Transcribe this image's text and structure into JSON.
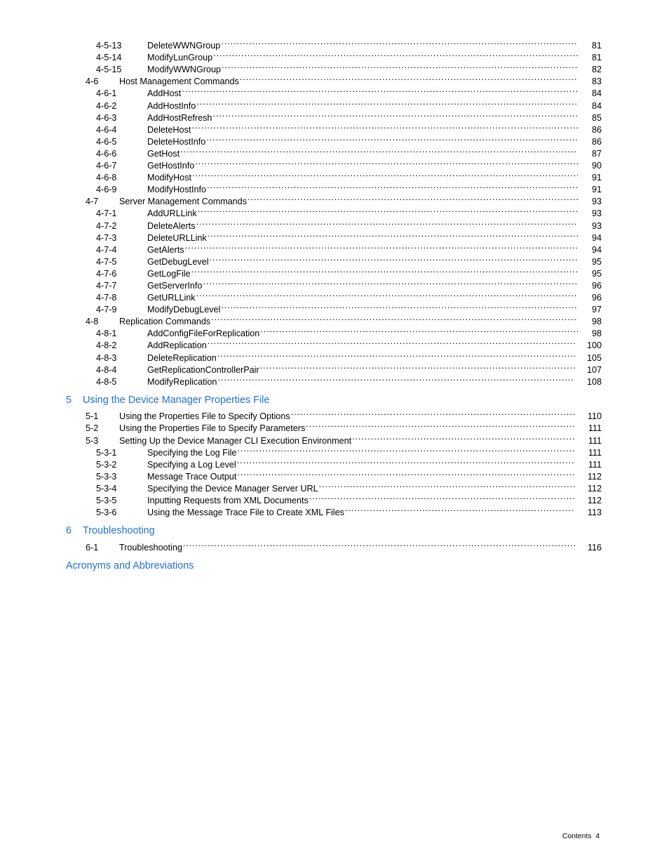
{
  "document": {
    "type": "table-of-contents",
    "footer_text": "Contents  4",
    "accent_color": "#2272D6",
    "text_color": "#000000",
    "background_color": "#FFFFFF"
  },
  "toc": {
    "entries": [
      {
        "kind": "item",
        "level": 3,
        "number": "4-5-13",
        "title": "DeleteWWNGroup",
        "page": "81"
      },
      {
        "kind": "item",
        "level": 3,
        "number": "4-5-14",
        "title": "ModifyLunGroup",
        "page": "81"
      },
      {
        "kind": "item",
        "level": 3,
        "number": "4-5-15",
        "title": "ModifyWWNGroup",
        "page": "82"
      },
      {
        "kind": "item",
        "level": 2,
        "number": "4-6",
        "title": "Host Management Commands",
        "page": "83"
      },
      {
        "kind": "item",
        "level": 3,
        "number": "4-6-1",
        "title": "AddHost",
        "page": "84"
      },
      {
        "kind": "item",
        "level": 3,
        "number": "4-6-2",
        "title": "AddHostInfo",
        "page": "84"
      },
      {
        "kind": "item",
        "level": 3,
        "number": "4-6-3",
        "title": "AddHostRefresh",
        "page": "85"
      },
      {
        "kind": "item",
        "level": 3,
        "number": "4-6-4",
        "title": "DeleteHost",
        "page": "86"
      },
      {
        "kind": "item",
        "level": 3,
        "number": "4-6-5",
        "title": "DeleteHostInfo",
        "page": "86"
      },
      {
        "kind": "item",
        "level": 3,
        "number": "4-6-6",
        "title": "GetHost",
        "page": "87"
      },
      {
        "kind": "item",
        "level": 3,
        "number": "4-6-7",
        "title": "GetHostInfo",
        "page": "90"
      },
      {
        "kind": "item",
        "level": 3,
        "number": "4-6-8",
        "title": "ModifyHost",
        "page": "91"
      },
      {
        "kind": "item",
        "level": 3,
        "number": "4-6-9",
        "title": "ModifyHostInfo",
        "page": "91"
      },
      {
        "kind": "item",
        "level": 2,
        "number": "4-7",
        "title": "Server Management Commands",
        "page": "93"
      },
      {
        "kind": "item",
        "level": 3,
        "number": "4-7-1",
        "title": "AddURLLink",
        "page": "93"
      },
      {
        "kind": "item",
        "level": 3,
        "number": "4-7-2",
        "title": "DeleteAlerts",
        "page": "93"
      },
      {
        "kind": "item",
        "level": 3,
        "number": "4-7-3",
        "title": "DeleteURLLink",
        "page": "94"
      },
      {
        "kind": "item",
        "level": 3,
        "number": "4-7-4",
        "title": "GetAlerts",
        "page": "94"
      },
      {
        "kind": "item",
        "level": 3,
        "number": "4-7-5",
        "title": "GetDebugLevel",
        "page": "95"
      },
      {
        "kind": "item",
        "level": 3,
        "number": "4-7-6",
        "title": "GetLogFile",
        "page": "95"
      },
      {
        "kind": "item",
        "level": 3,
        "number": "4-7-7",
        "title": "GetServerInfo",
        "page": "96"
      },
      {
        "kind": "item",
        "level": 3,
        "number": "4-7-8",
        "title": "GetURLLink",
        "page": "96"
      },
      {
        "kind": "item",
        "level": 3,
        "number": "4-7-9",
        "title": "ModifyDebugLevel",
        "page": "97"
      },
      {
        "kind": "item",
        "level": 2,
        "number": "4-8",
        "title": "Replication Commands",
        "page": "98"
      },
      {
        "kind": "item",
        "level": 3,
        "number": "4-8-1",
        "title": "AddConfigFileForReplication",
        "page": "98"
      },
      {
        "kind": "item",
        "level": 3,
        "number": "4-8-2",
        "title": "AddReplication",
        "page": "100"
      },
      {
        "kind": "item",
        "level": 3,
        "number": "4-8-3",
        "title": "DeleteReplication",
        "page": "105"
      },
      {
        "kind": "item",
        "level": 3,
        "number": "4-8-4",
        "title": "GetReplicationControllerPair",
        "page": "107"
      },
      {
        "kind": "item",
        "level": 3,
        "number": "4-8-5",
        "title": "ModifyReplication",
        "page": "108"
      },
      {
        "kind": "gap"
      },
      {
        "kind": "chapter",
        "number": "5",
        "title": "Using the Device Manager Properties File"
      },
      {
        "kind": "item",
        "level": 2,
        "number": "5-1",
        "title": "Using the Properties File to Specify Options",
        "page": "110"
      },
      {
        "kind": "item",
        "level": 2,
        "number": "5-2",
        "title": "Using the Properties File to Specify Parameters",
        "page": "111"
      },
      {
        "kind": "item",
        "level": 2,
        "number": "5-3",
        "title": "Setting Up the Device Manager CLI Execution Environment",
        "page": "111"
      },
      {
        "kind": "item",
        "level": 3,
        "number": "5-3-1",
        "title": "Specifying the Log File",
        "page": "111"
      },
      {
        "kind": "item",
        "level": 3,
        "number": "5-3-2",
        "title": "Specifying a Log Level",
        "page": "111"
      },
      {
        "kind": "item",
        "level": 3,
        "number": "5-3-3",
        "title": "Message Trace Output",
        "page": "112"
      },
      {
        "kind": "item",
        "level": 3,
        "number": "5-3-4",
        "title": "Specifying the Device Manager Server URL",
        "page": "112"
      },
      {
        "kind": "item",
        "level": 3,
        "number": "5-3-5",
        "title": "Inputting Requests from XML Documents",
        "page": "112"
      },
      {
        "kind": "item",
        "level": 3,
        "number": "5-3-6",
        "title": "Using the Message Trace File to Create XML Files",
        "page": "113"
      },
      {
        "kind": "gap"
      },
      {
        "kind": "chapter",
        "number": "6",
        "title": "Troubleshooting"
      },
      {
        "kind": "item",
        "level": 2,
        "number": "6-1",
        "title": "Troubleshooting",
        "page": "116"
      },
      {
        "kind": "gap"
      },
      {
        "kind": "appendix",
        "title": "Acronyms and Abbreviations"
      }
    ]
  }
}
